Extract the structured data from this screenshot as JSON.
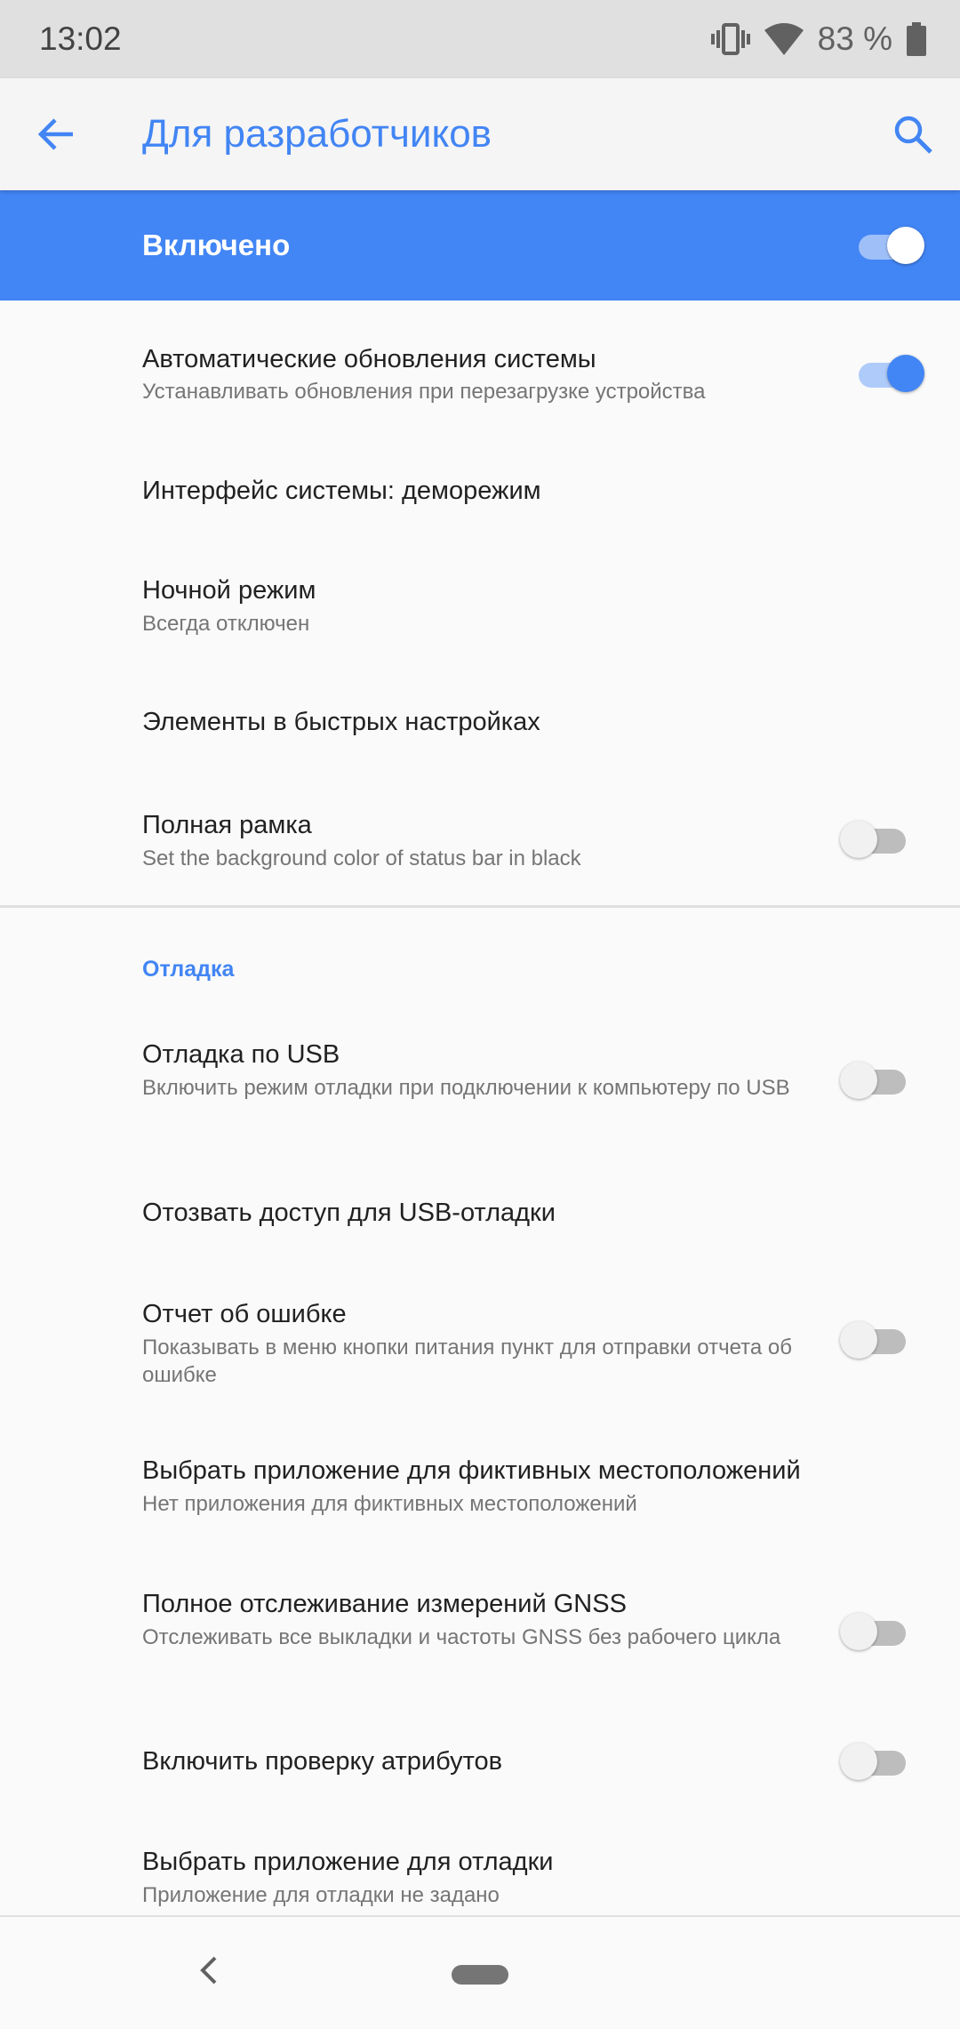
{
  "status": {
    "time": "13:02",
    "battery": "83 %"
  },
  "appbar": {
    "title": "Для разработчиков"
  },
  "master": {
    "label": "Включено",
    "on": true
  },
  "items": [
    {
      "title": "Автоматические обновления системы",
      "subtitle": "Устанавливать обновления при перезагрузке устройства",
      "toggle": "on"
    },
    {
      "title": "Интерфейс системы: деморежим"
    },
    {
      "title": "Ночной режим",
      "subtitle": "Всегда отключен"
    },
    {
      "title": "Элементы в быстрых настройках"
    },
    {
      "title": "Полная рамка",
      "subtitle": "Set the background color of status bar in black",
      "toggle": "off"
    }
  ],
  "section_debug": "Отладка",
  "debug_items": [
    {
      "title": "Отладка по USB",
      "subtitle": "Включить режим отладки при подключении к компьютеру по USB",
      "toggle": "off"
    },
    {
      "title": "Отозвать доступ для USB-отладки"
    },
    {
      "title": "Отчет об ошибке",
      "subtitle": "Показывать в меню кнопки питания пункт для отправки отчета об ошибке",
      "toggle": "off"
    },
    {
      "title": "Выбрать приложение для фиктивных местоположений",
      "subtitle": "Нет приложения для фиктивных местоположений"
    },
    {
      "title": "Полное отслеживание измерений GNSS",
      "subtitle": "Отслеживать все выкладки и частоты GNSS без рабочего цикла",
      "toggle": "off"
    },
    {
      "title": "Включить проверку атрибутов",
      "toggle": "off"
    },
    {
      "title": "Выбрать приложение для отладки",
      "subtitle": "Приложение для отладки не задано"
    }
  ],
  "colors": {
    "accent": "#4285f4",
    "statusbar": "#e0e0e0",
    "background": "#fafafa"
  }
}
